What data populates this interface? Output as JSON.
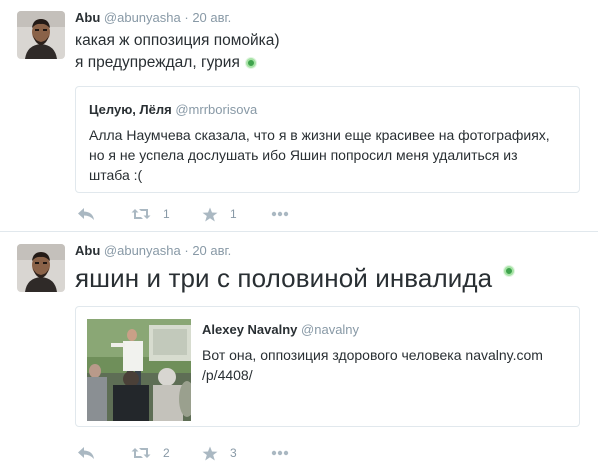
{
  "tweets": [
    {
      "author_name": "Abu",
      "author_handle": "@abunyasha",
      "separator": "·",
      "date": "20 авг.",
      "lines": [
        "какая ж оппозиция помойка)",
        "я предупреждал, гурия"
      ],
      "quote": {
        "name": "Целую, Лёля",
        "handle": "@mrrborisova",
        "lines": [
          "Алла Наумчева сказала, что я в жизни еще красивее на фотографиях,",
          "но я не успела дослушать ибо Яшин попросил меня удалиться из",
          "штаба :("
        ]
      },
      "actions": {
        "retweets": "1",
        "favorites": "1"
      }
    },
    {
      "author_name": "Abu",
      "author_handle": "@abunyasha",
      "separator": "·",
      "date": "20 авг.",
      "text": "яшин и три с половиной инвалида",
      "quote": {
        "name": "Alexey Navalny",
        "handle": "@navalny",
        "lines": [
          "Вот она, оппозиция здорового человека navalny.com",
          "/p/4408/"
        ]
      },
      "actions": {
        "retweets": "2",
        "favorites": "3"
      }
    }
  ],
  "icons": {
    "reply": "reply-icon",
    "retweet": "retweet-icon",
    "favorite": "star-icon",
    "more": "more-icon",
    "status": "online-status-icon"
  },
  "colors": {
    "icon_gray": "#aab8c2",
    "meta_gray": "#8899a6",
    "text": "#292f33",
    "border": "#e1e8ed",
    "status_green": "#3fa34d"
  }
}
